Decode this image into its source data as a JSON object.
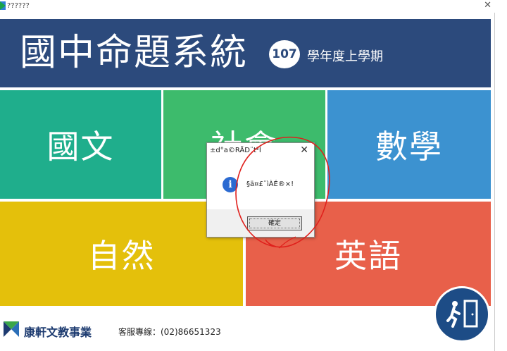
{
  "window": {
    "title": "??????",
    "close_glyph": "✕"
  },
  "header": {
    "title": "國中命題系統",
    "year_badge": "107",
    "subtitle": "學年度上學期"
  },
  "subjects": [
    {
      "label": "國文",
      "color": "#1fae8c"
    },
    {
      "label": "社會",
      "color": "#3dbb6c"
    },
    {
      "label": "數學",
      "color": "#3c92d0"
    },
    {
      "label": "自然",
      "color": "#e4c00b"
    },
    {
      "label": "英語",
      "color": "#e8604a"
    }
  ],
  "footer": {
    "brand": "康軒文教事業",
    "hotline": "客服專線：(02)86651323"
  },
  "dialog": {
    "title": "±d°a©RÃD¨t²Î",
    "message": "§ä¤£¨ìÀÉ®×!",
    "ok_label": "確定",
    "close_glyph": "✕",
    "icon": "info-icon"
  },
  "colors": {
    "header_bg": "#2c4a7c",
    "exit_button": "#1d4c86",
    "annotation": "#e0201c"
  }
}
